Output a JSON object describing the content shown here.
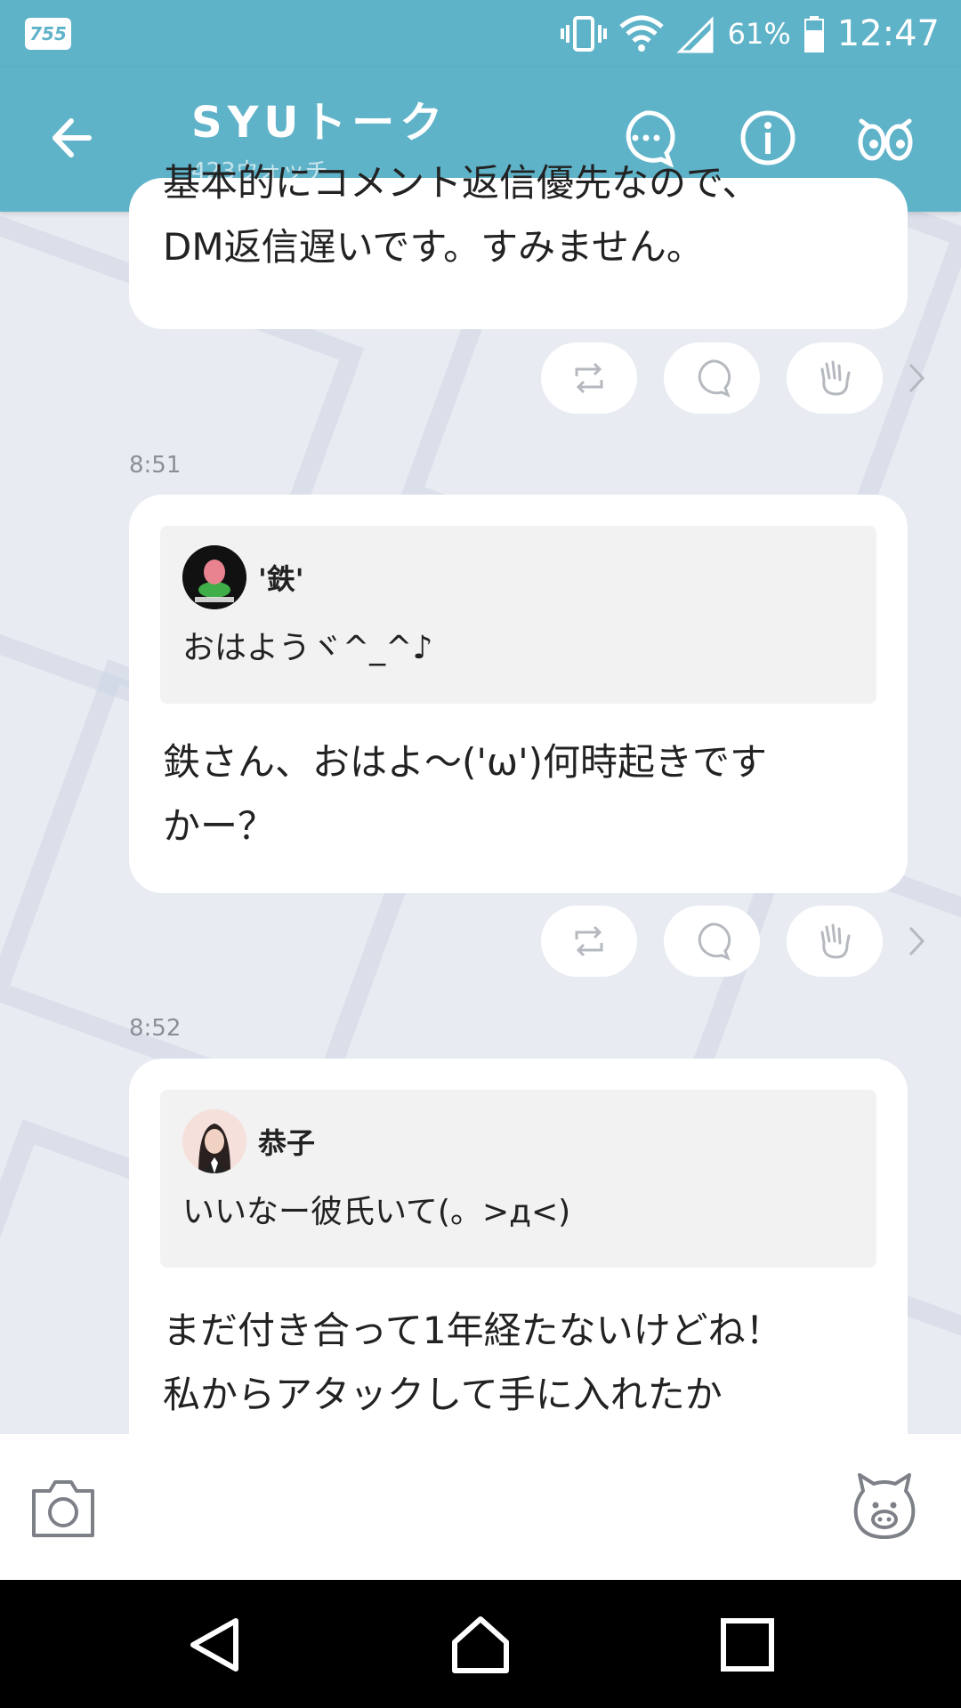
{
  "colors": {
    "header": "#5fb3c9",
    "background": "#e8ecf2",
    "card": "#ffffff",
    "quote_bg": "#f2f2f2"
  },
  "status_bar": {
    "app_badge": "755",
    "battery": "61%",
    "time": "12:47"
  },
  "header": {
    "title": "SYUトーク",
    "subtitle": "423ウォッチ"
  },
  "messages": [
    {
      "text_lines": [
        "基本的にコメント返信優先なので、",
        "DM返信遅いです。すみません。"
      ]
    },
    {
      "time": "8:51",
      "quote": {
        "name": "'鉄'",
        "text": "おはようヾ^_^♪"
      },
      "text_lines": [
        "鉄さん、おはよ〜('ω')何時起きです",
        "かー？"
      ]
    },
    {
      "time": "8:52",
      "quote": {
        "name": "恭子",
        "text": "いいなー彼氏いて(。>д<)"
      },
      "text_lines": [
        "まだ付き合って1年経たないけどね！",
        "私からアタックして手に入れたか"
      ]
    }
  ],
  "icons": {
    "header": [
      "back-arrow-icon",
      "chat-bubble-icon",
      "info-icon",
      "watch-eyes-icon"
    ],
    "actions": [
      "repost-icon",
      "comment-icon",
      "clap-icon",
      "chevron-right-icon"
    ],
    "input": [
      "camera-icon",
      "stamp-icon"
    ],
    "system": [
      "back-triangle-icon",
      "home-icon",
      "recents-icon"
    ]
  }
}
